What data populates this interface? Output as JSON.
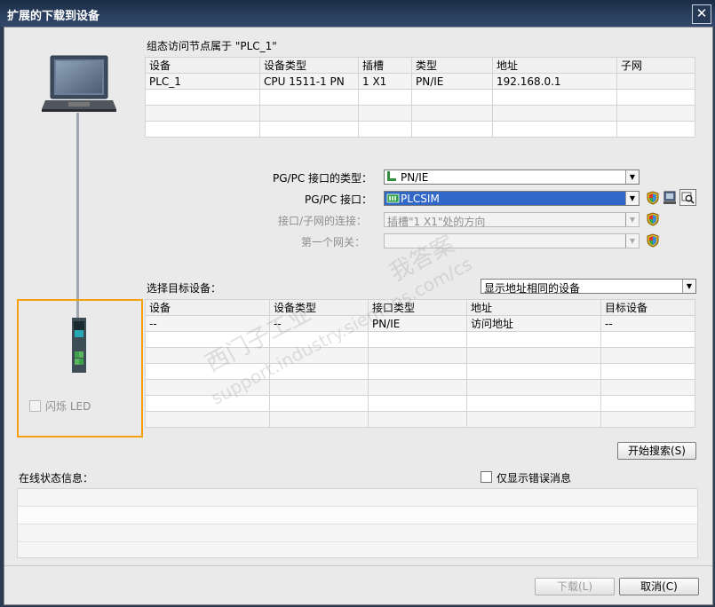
{
  "window": {
    "title": "扩展的下载到设备",
    "close_label": "✕"
  },
  "configured": {
    "heading": "组态访问节点属于 \"PLC_1\"",
    "columns": [
      "设备",
      "设备类型",
      "插槽",
      "类型",
      "地址",
      "子网"
    ],
    "rows": [
      [
        "PLC_1",
        "CPU 1511-1 PN",
        "1 X1",
        "PN/IE",
        "192.168.0.1",
        ""
      ]
    ]
  },
  "settings": {
    "pgpc_type_label": "PG/PC 接口的类型：",
    "pgpc_type_value": "PN/IE",
    "pgpc_iface_label": "PG/PC 接口：",
    "pgpc_iface_value": "PLCSIM",
    "subnet_conn_label": "接口/子网的连接：",
    "subnet_conn_value": "插槽\"1 X1\"处的方向",
    "gateway_label": "第一个网关：",
    "gateway_value": ""
  },
  "target": {
    "heading": "选择目标设备：",
    "filter_value": "显示地址相同的设备",
    "columns": [
      "设备",
      "设备类型",
      "接口类型",
      "地址",
      "目标设备"
    ],
    "rows": [
      [
        "--",
        "--",
        "PN/IE",
        "访问地址",
        "--"
      ]
    ]
  },
  "device_panel": {
    "flash_led_label": "闪烁 LED"
  },
  "search_button": "开始搜索(S)",
  "status": {
    "heading": "在线状态信息：",
    "errors_only_label": "仅显示错误消息"
  },
  "footer": {
    "download_button": "下载(L)",
    "cancel_button": "取消(C)"
  },
  "watermark": {
    "line1": "西门子工业",
    "line2": "我答案",
    "line3": "support.industry.siemens.com/cs"
  },
  "colors": {
    "highlight_frame": "#f5a00f",
    "selection": "#3168c8",
    "titlebar": "#1b2d46"
  },
  "icons": [
    "laptop-icon",
    "plc-icon",
    "network-icon",
    "plcsim-icon",
    "shield-icon",
    "properties-icon",
    "search-icon"
  ]
}
